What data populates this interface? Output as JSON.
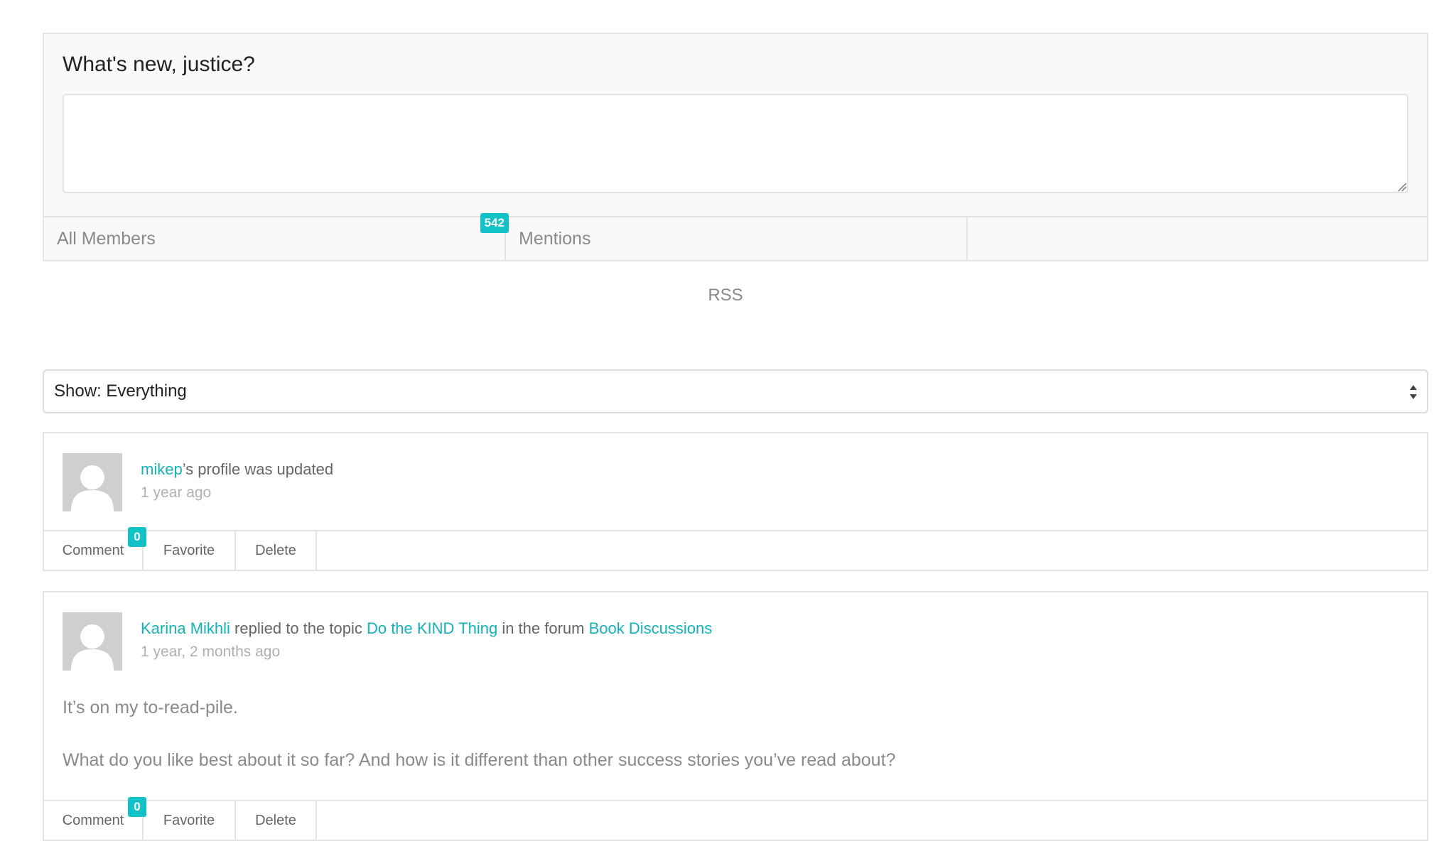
{
  "post_form": {
    "greeting": "What's new, justice?",
    "textarea_value": "",
    "tabs": [
      {
        "label": "All Members",
        "count": "542"
      },
      {
        "label": "Mentions"
      },
      {
        "label": ""
      }
    ]
  },
  "rss_label": "RSS",
  "filter": {
    "selected": "Show: Everything"
  },
  "activities": [
    {
      "author": "mikep",
      "action_text": "’s profile was updated",
      "time": "1 year ago",
      "actions": {
        "comment_label": "Comment",
        "comment_count": "0",
        "favorite_label": "Favorite",
        "delete_label": "Delete"
      }
    },
    {
      "author": "Karina Mikhli",
      "action_text_1": " replied to the topic ",
      "topic": "Do the KIND Thing",
      "action_text_2": " in the forum ",
      "forum": "Book Discussions",
      "time": "1 year, 2 months ago",
      "content": [
        "It’s on my to-read-pile.",
        "What do you like best about it so far? And how is it different than other success stories you’ve read about?"
      ],
      "actions": {
        "comment_label": "Comment",
        "comment_count": "0",
        "favorite_label": "Favorite",
        "delete_label": "Delete"
      }
    }
  ],
  "colors": {
    "accent": "#13c2c6",
    "link": "#13b3b8",
    "border": "#e4e4e4"
  }
}
